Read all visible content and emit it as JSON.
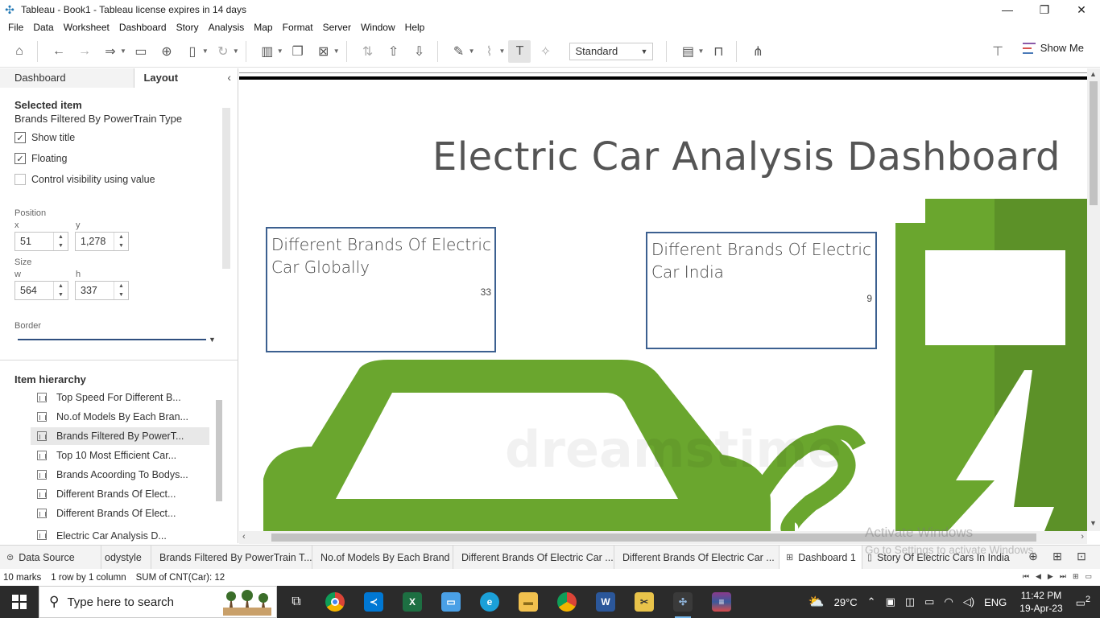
{
  "window": {
    "title": "Tableau - Book1 - Tableau license expires in 14 days",
    "controls": [
      "—",
      "❐",
      "✕"
    ]
  },
  "menu": [
    "File",
    "Data",
    "Worksheet",
    "Dashboard",
    "Story",
    "Analysis",
    "Map",
    "Format",
    "Server",
    "Window",
    "Help"
  ],
  "toolbar": {
    "fit_value": "Standard",
    "show_me_label": "Show Me"
  },
  "left_panel": {
    "tabs": [
      "Dashboard",
      "Layout"
    ],
    "selected_item_heading": "Selected item",
    "selected_item_name": "Brands Filtered By PowerTrain Type",
    "show_title_label": "Show title",
    "floating_label": "Floating",
    "control_visibility_label": "Control visibility using value",
    "position_heading": "Position",
    "x_label": "x",
    "y_label": "y",
    "x_value": "51",
    "y_value": "1,278",
    "size_heading": "Size",
    "w_label": "w",
    "h_label": "h",
    "w_value": "564",
    "h_value": "337",
    "border_heading": "Border",
    "hierarchy_heading": "Item hierarchy",
    "hierarchy": [
      "Top Speed For Different B...",
      "No.of Models By Each Bran...",
      "Brands Filtered By PowerT...",
      "Top 10 Most Efficient Car...",
      "Brands Acoording To Bodys...",
      "Different Brands Of Elect...",
      "Different Brands Of Elect...",
      "Electric Car Analysis D..."
    ]
  },
  "dashboard": {
    "title": "Electric Car Analysis Dashboard",
    "kpi_global_title": "Different Brands Of Electric Car Globally",
    "kpi_global_value": "33",
    "kpi_india_title": "Different Brands Of Electric Car India",
    "kpi_india_value": "9",
    "image_color": "#6aa62e"
  },
  "sheet_tabs": {
    "data_source": "Data Source",
    "tabs": [
      "odystyle",
      "Brands Filtered By PowerTrain T...",
      "No.of Models By Each Brand",
      "Different Brands Of Electric Car ...",
      "Different Brands Of Electric Car ...",
      "Dashboard 1",
      "Story Of Electric Cars In India"
    ]
  },
  "watermark": {
    "line1": "Activate Windows",
    "line2": "Go to Settings to activate Windows."
  },
  "status": {
    "marks": "10 marks",
    "rows_cols": "1 row by 1 column",
    "sum": "SUM of CNT(Car): 12"
  },
  "taskbar": {
    "search_placeholder": "Type here to search",
    "temperature": "29°C",
    "language": "ENG",
    "time": "11:42 PM",
    "date": "19-Apr-23",
    "notifications": "2"
  }
}
